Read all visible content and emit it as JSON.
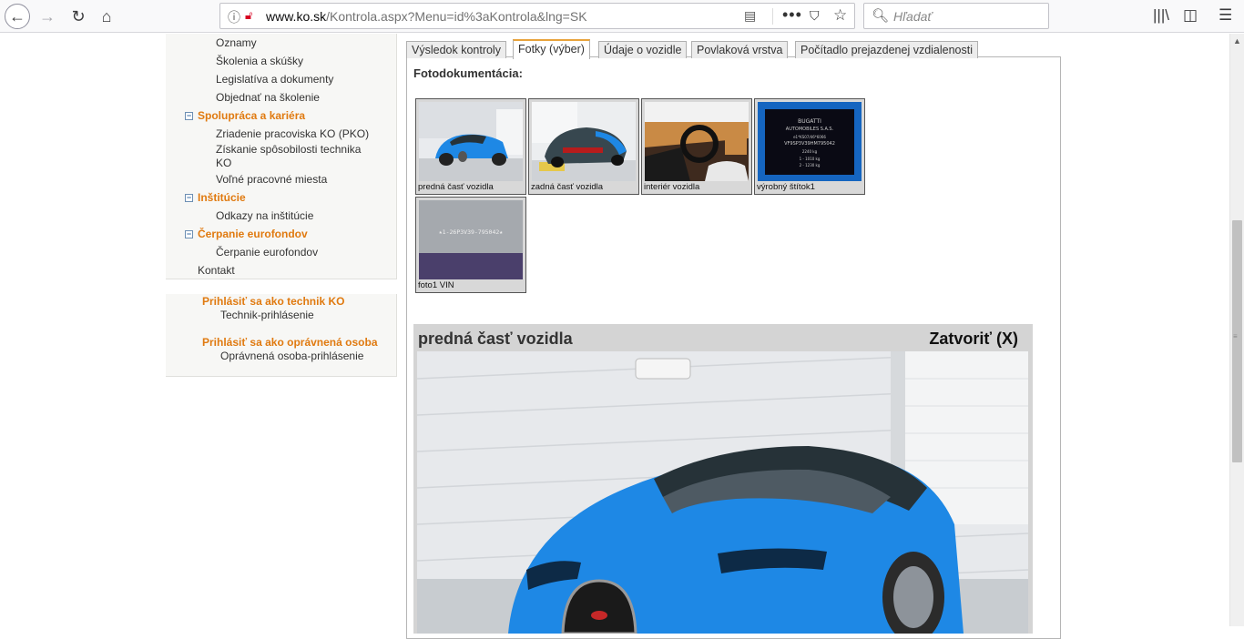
{
  "browser": {
    "url_host": "www.ko.sk",
    "url_path": "/Kontrola.aspx?Menu=id%3aKontrola&lng=SK",
    "search_placeholder": "Hľadať",
    "icons": [
      "back-arrow-icon",
      "forward-arrow-icon",
      "reload-icon",
      "home-icon",
      "info-icon",
      "insecure-lock-icon",
      "reader-view-icon",
      "more-dots-icon",
      "pocket-icon",
      "bookmark-star-icon",
      "search-icon",
      "library-icon",
      "sidebar-icon",
      "hamburger-menu-icon"
    ]
  },
  "sidebar": {
    "top_items": [
      "Oznamy",
      "Školenia a skúšky",
      "Legislatíva a dokumenty",
      "Objednať na školenie"
    ],
    "sections": [
      {
        "title": "Spolupráca a kariéra",
        "items": [
          "Zriadenie pracoviska KO (PKO)",
          "Získanie spôsobilosti technika KO",
          "Voľné pracovné miesta"
        ]
      },
      {
        "title": "Inštitúcie",
        "items": [
          "Odkazy na inštitúcie"
        ]
      },
      {
        "title": "Čerpanie eurofondov",
        "items": [
          "Čerpanie eurofondov"
        ]
      }
    ],
    "toggle_symbol": "−",
    "kontakt": "Kontakt"
  },
  "login": {
    "tech_title": "Prihlásiť sa ako technik KO",
    "tech_link": "Technik-prihlásenie",
    "auth_title": "Prihlásiť sa ako oprávnená osoba",
    "auth_link": "Oprávnená osoba-prihlásenie"
  },
  "tabs": [
    "Výsledok kontroly",
    "Fotky (výber)",
    "Údaje o vozidle",
    "Povlaková vrstva",
    "Počítadlo prejazdenej vzdialenosti"
  ],
  "active_tab": 1,
  "content": {
    "section_title": "Fotodokumentácia:",
    "thumbnails": [
      "predná časť vozidla",
      "zadná časť vozidla",
      "interiér vozidla",
      "výrobný štítok1",
      "foto1 VIN"
    ],
    "plate_text": [
      "BUGATTI",
      "AUTOMOBILES S.A.S.",
      "e1*KS07/46*6066",
      "VF9SP3V39HM795042",
      "2240 kg",
      "1 - 1010 kg",
      "2 - 1230 kg"
    ],
    "vin_text": "★1-26P3V39-795042★"
  },
  "viewer": {
    "title": "predná časť vozidla",
    "close": "Zatvoriť (X)"
  },
  "colors": {
    "accent_orange": "#e07a10",
    "car_blue": "#1e88e5",
    "tab_active_border": "#e8a33c"
  }
}
